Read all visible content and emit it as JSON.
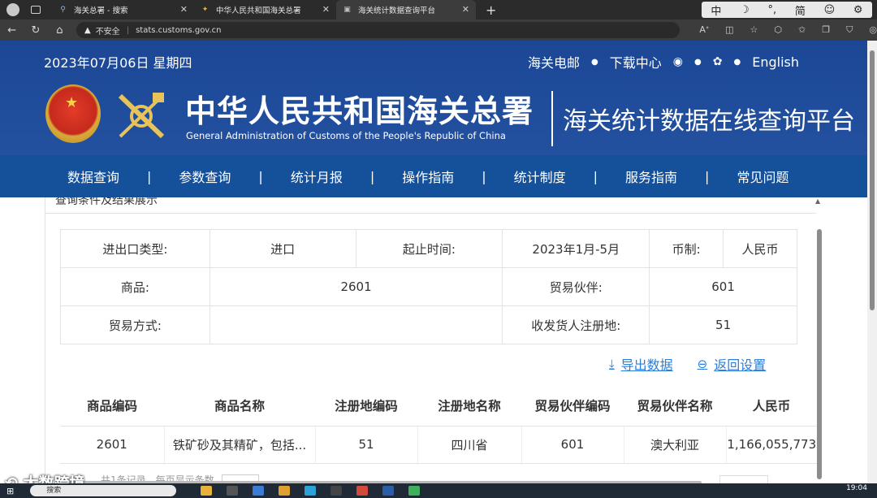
{
  "browser": {
    "tabs": [
      {
        "label": "海关总署 - 搜索",
        "active": false
      },
      {
        "label": "中华人民共和国海关总署",
        "active": false
      },
      {
        "label": "海关统计数据查询平台",
        "active": true
      }
    ],
    "ime": [
      "中",
      "☽",
      "°,",
      "简",
      "☺",
      "⚙"
    ],
    "security": "不安全",
    "url": "stats.customs.gov.cn"
  },
  "header": {
    "date": "2023年07月06日 星期四",
    "links": [
      "海关电邮",
      "下载中心",
      "English"
    ],
    "title_cn": "中华人民共和国海关总署",
    "title_en": "General Administration of Customs of the People's Republic of China",
    "subtitle": "海关统计数据在线查询平台"
  },
  "nav": [
    "数据查询",
    "参数查询",
    "统计月报",
    "操作指南",
    "统计制度",
    "服务指南",
    "常见问题"
  ],
  "section_title": "查询条件及结果展示",
  "query": {
    "trade_type_label": "进出口类型:",
    "trade_type": "进口",
    "period_label": "起止时间:",
    "period": "2023年1月-5月",
    "currency_label": "币制:",
    "currency": "人民币",
    "goods_label": "商品:",
    "goods": "2601",
    "partner_label": "贸易伙伴:",
    "partner": "601",
    "mode_label": "贸易方式:",
    "mode": "",
    "region_label": "收发货人注册地:",
    "region": "51"
  },
  "actions": {
    "export": "导出数据",
    "back": "返回设置"
  },
  "result": {
    "columns": [
      "商品编码",
      "商品名称",
      "注册地编码",
      "注册地名称",
      "贸易伙伴编码",
      "贸易伙伴名称",
      "人民币"
    ],
    "rows": [
      [
        "2601",
        "铁矿砂及其精矿，包括...",
        "51",
        "四川省",
        "601",
        "澳大利亚",
        "1,166,055,773"
      ]
    ]
  },
  "pager": {
    "text": "共1条记录，每页显示条数"
  },
  "watermark": "大数跨境",
  "taskbar": {
    "search": "搜索",
    "time": "19:04"
  }
}
